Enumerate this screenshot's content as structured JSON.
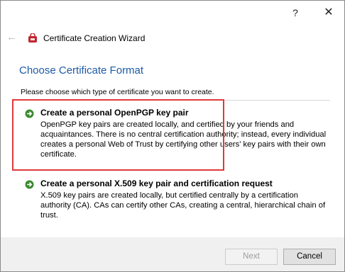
{
  "titlebar": {
    "help_label": "?",
    "close_label": "✕"
  },
  "header": {
    "back_label": "←",
    "wizard_title": "Certificate Creation Wizard"
  },
  "page": {
    "heading": "Choose Certificate Format",
    "instruction": "Please choose which type of certificate you want to create."
  },
  "options": [
    {
      "title": "Create a personal OpenPGP key pair",
      "description": "OpenPGP key pairs are created locally, and certified by your friends and acquaintances. There is no central certification authority; instead, every individual creates a personal Web of Trust by certifying other users' key pairs with their own certificate."
    },
    {
      "title": "Create a personal X.509 key pair and certification request",
      "description": "X.509 key pairs are created locally, but certified centrally by a certification authority (CA). CAs can certify other CAs, creating a central, hierarchical chain of trust."
    }
  ],
  "buttons": {
    "next": "Next",
    "cancel": "Cancel"
  },
  "colors": {
    "heading": "#1c5aa6",
    "highlight": "#e03a3a",
    "arrow_icon": "#3a8a2e"
  }
}
